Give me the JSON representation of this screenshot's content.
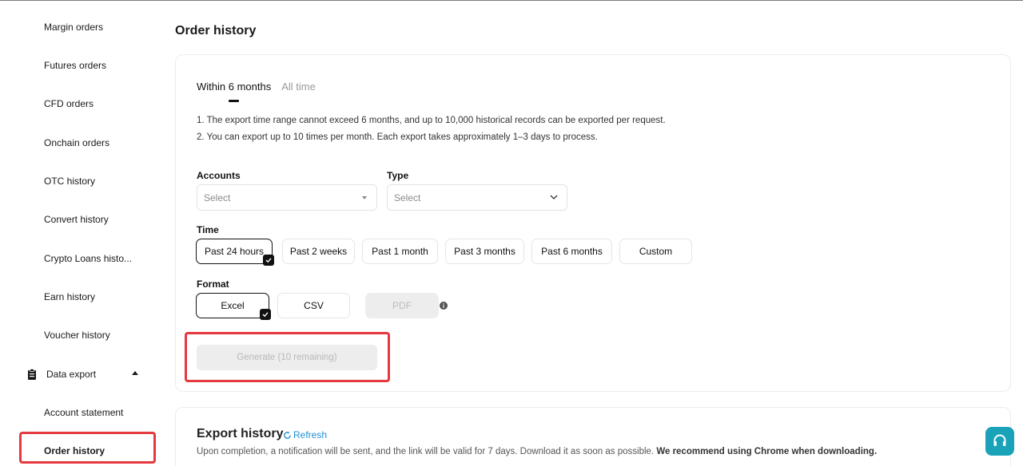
{
  "sidebar": {
    "items": [
      {
        "label": "Margin orders"
      },
      {
        "label": "Futures orders"
      },
      {
        "label": "CFD orders"
      },
      {
        "label": "Onchain orders"
      },
      {
        "label": "OTC history"
      },
      {
        "label": "Convert history"
      },
      {
        "label": "Crypto Loans histo..."
      },
      {
        "label": "Earn history"
      },
      {
        "label": "Voucher history"
      }
    ],
    "group": {
      "label": "Data export",
      "icon": "clipboard-icon"
    },
    "sub_items": [
      {
        "label": "Account statement"
      },
      {
        "label": "Order history",
        "active": true
      }
    ]
  },
  "page": {
    "title": "Order history"
  },
  "tabs": [
    {
      "label": "Within 6 months",
      "active": true
    },
    {
      "label": "All time",
      "active": false
    }
  ],
  "notes": [
    "1. The export time range cannot exceed 6 months, and up to 10,000 historical records can be exported per request.",
    "2. You can export up to 10 times per month. Each export takes approximately 1–3 days to process."
  ],
  "form": {
    "accounts": {
      "label": "Accounts",
      "placeholder": "Select"
    },
    "type": {
      "label": "Type",
      "placeholder": "Select"
    },
    "time": {
      "label": "Time",
      "options": [
        "Past 24 hours",
        "Past 2 weeks",
        "Past 1 month",
        "Past 3 months",
        "Past 6 months",
        "Custom"
      ],
      "selected": "Past 24 hours"
    },
    "format": {
      "label": "Format",
      "options": [
        "Excel",
        "CSV",
        "PDF"
      ],
      "selected": "Excel",
      "disabled": [
        "PDF"
      ]
    },
    "generate_label": "Generate (10 remaining)"
  },
  "export_history": {
    "title": "Export history",
    "refresh_label": "Refresh",
    "note_plain": "Upon completion, a notification will be sent, and the link will be valid for 7 days. Download it as soon as possible. ",
    "note_bold": "We recommend using Chrome when downloading."
  },
  "colors": {
    "highlight": "#e5383f",
    "accent": "#1e8fd6",
    "support": "#1aa3b8"
  }
}
